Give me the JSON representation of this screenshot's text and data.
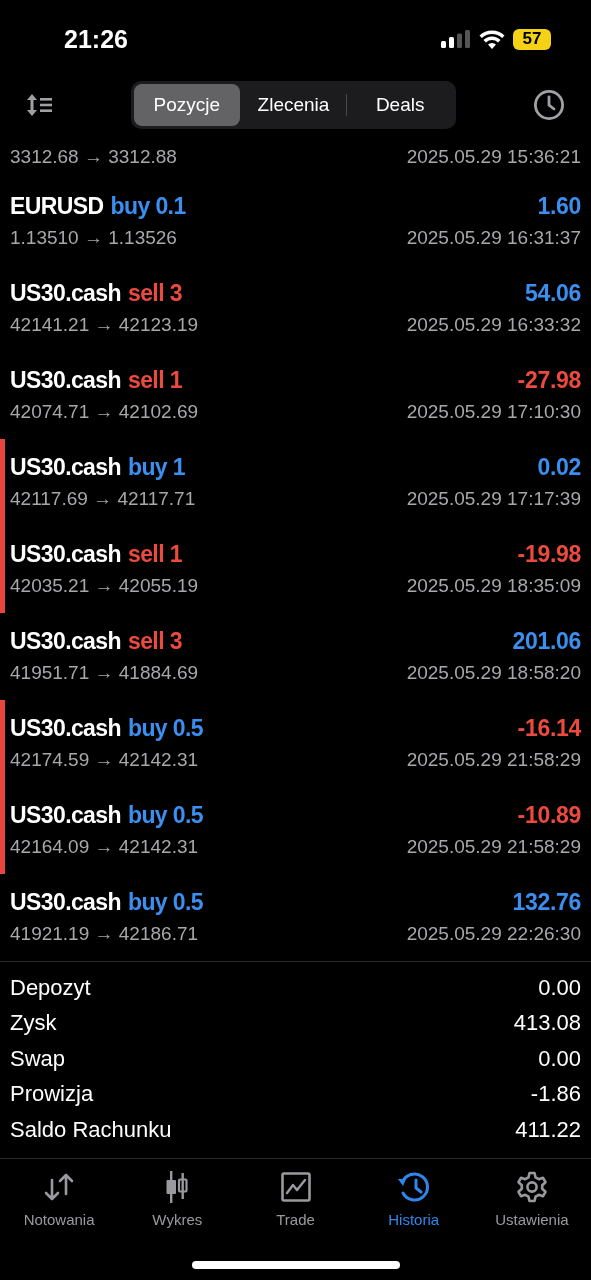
{
  "status_bar": {
    "time": "21:26",
    "battery": "57"
  },
  "tabs": [
    {
      "label": "Pozycje",
      "selected": true
    },
    {
      "label": "Zlecenia",
      "selected": false
    },
    {
      "label": "Deals",
      "selected": false
    }
  ],
  "partial_row": {
    "prices": "3312.68 → 3312.88",
    "time": "2025.05.29 15:36:21"
  },
  "rows": [
    {
      "symbol": "EURUSD",
      "order": {
        "text": "buy 0.1",
        "color": "#3a8ff0"
      },
      "profit": {
        "text": "1.60",
        "color": "#3a8ff0"
      },
      "prices": "1.13510 → 1.13526",
      "time": "2025.05.29 16:31:37",
      "marked": false
    },
    {
      "symbol": "US30.cash",
      "order": {
        "text": "sell 3",
        "color": "#ec4a3f"
      },
      "profit": {
        "text": "54.06",
        "color": "#3a8ff0"
      },
      "prices": "42141.21 → 42123.19",
      "time": "2025.05.29 16:33:32",
      "marked": false
    },
    {
      "symbol": "US30.cash",
      "order": {
        "text": "sell 1",
        "color": "#ec4a3f"
      },
      "profit": {
        "text": "-27.98",
        "color": "#ec4a3f"
      },
      "prices": "42074.71 → 42102.69",
      "time": "2025.05.29 17:10:30",
      "marked": false
    },
    {
      "symbol": "US30.cash",
      "order": {
        "text": "buy 1",
        "color": "#3a8ff0"
      },
      "profit": {
        "text": "0.02",
        "color": "#3a8ff0"
      },
      "prices": "42117.69 → 42117.71",
      "time": "2025.05.29 17:17:39",
      "marked": true
    },
    {
      "symbol": "US30.cash",
      "order": {
        "text": "sell 1",
        "color": "#ec4a3f"
      },
      "profit": {
        "text": "-19.98",
        "color": "#ec4a3f"
      },
      "prices": "42035.21 → 42055.19",
      "time": "2025.05.29 18:35:09",
      "marked": true
    },
    {
      "symbol": "US30.cash",
      "order": {
        "text": "sell 3",
        "color": "#ec4a3f"
      },
      "profit": {
        "text": "201.06",
        "color": "#3a8ff0"
      },
      "prices": "41951.71 → 41884.69",
      "time": "2025.05.29 18:58:20",
      "marked": false
    },
    {
      "symbol": "US30.cash",
      "order": {
        "text": "buy 0.5",
        "color": "#3a8ff0"
      },
      "profit": {
        "text": "-16.14",
        "color": "#ec4a3f"
      },
      "prices": "42174.59 → 42142.31",
      "time": "2025.05.29 21:58:29",
      "marked": true
    },
    {
      "symbol": "US30.cash",
      "order": {
        "text": "buy 0.5",
        "color": "#3a8ff0"
      },
      "profit": {
        "text": "-10.89",
        "color": "#ec4a3f"
      },
      "prices": "42164.09 → 42142.31",
      "time": "2025.05.29 21:58:29",
      "marked": true
    },
    {
      "symbol": "US30.cash",
      "order": {
        "text": "buy 0.5",
        "color": "#3a8ff0"
      },
      "profit": {
        "text": "132.76",
        "color": "#3a8ff0"
      },
      "prices": "41921.19 → 42186.71",
      "time": "2025.05.29 22:26:30",
      "marked": false
    }
  ],
  "summary": [
    {
      "label": "Depozyt",
      "value": "0.00"
    },
    {
      "label": "Zysk",
      "value": "413.08"
    },
    {
      "label": "Swap",
      "value": "0.00"
    },
    {
      "label": "Prowizja",
      "value": "-1.86"
    },
    {
      "label": "Saldo Rachunku",
      "value": "411.22"
    }
  ],
  "nav": [
    {
      "label": "Notowania",
      "kind": "quotes",
      "selected": false
    },
    {
      "label": "Wykres",
      "kind": "chart",
      "selected": false
    },
    {
      "label": "Trade",
      "kind": "trade",
      "selected": false
    },
    {
      "label": "Historia",
      "kind": "history",
      "selected": true
    },
    {
      "label": "Ustawienia",
      "kind": "settings",
      "selected": false
    }
  ]
}
